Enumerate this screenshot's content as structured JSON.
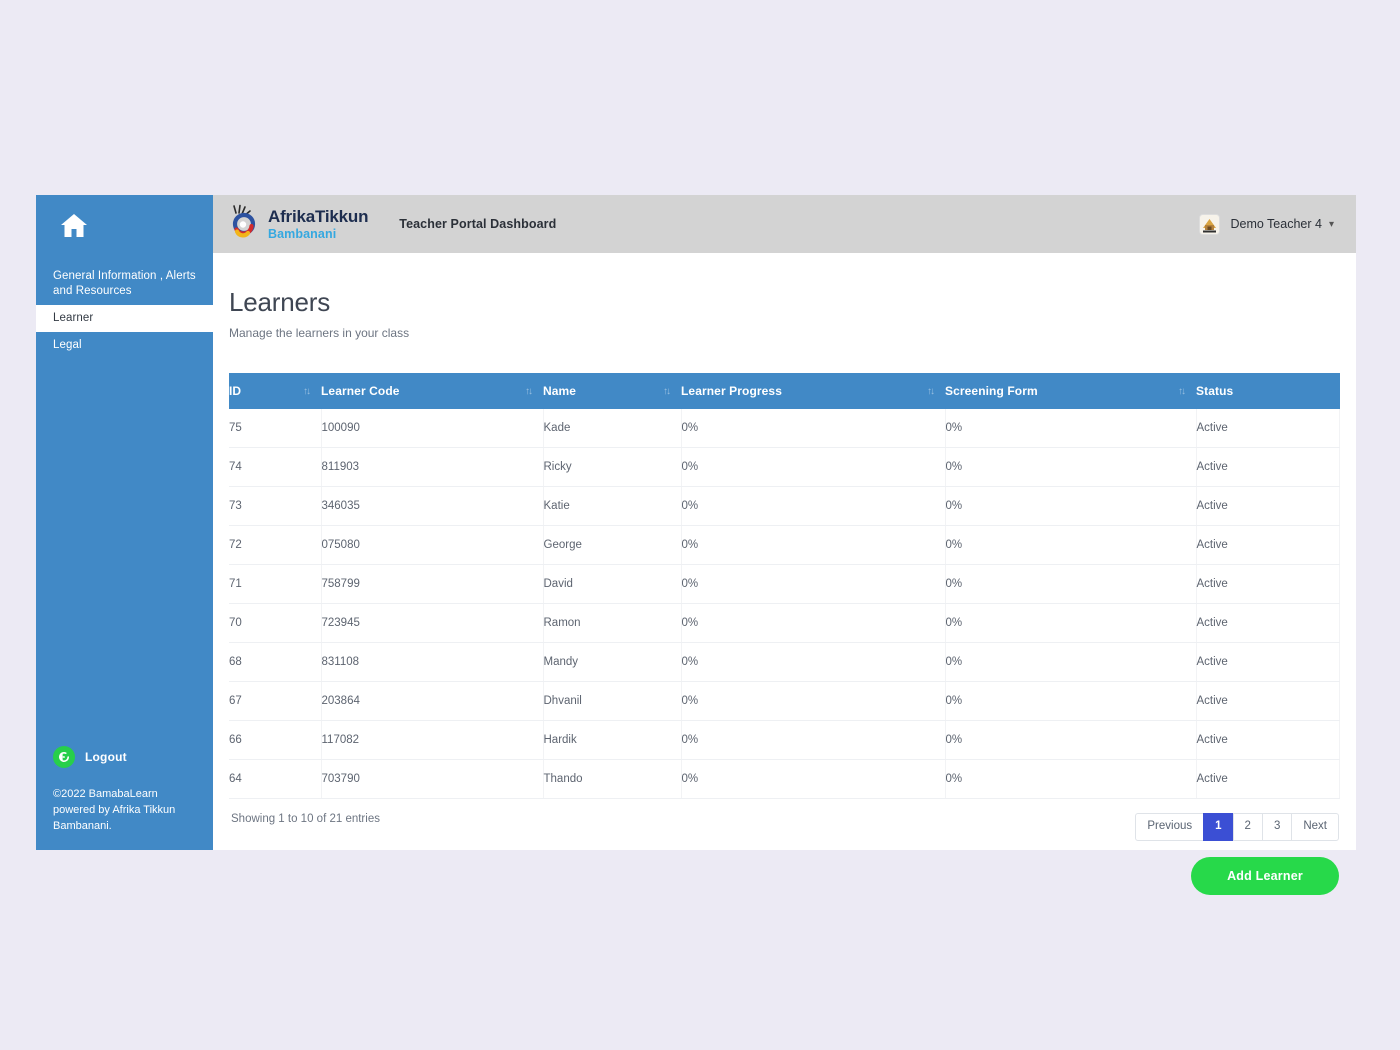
{
  "sidebar": {
    "home_icon": "home-icon",
    "items": [
      {
        "label": "General Information , Alerts and Resources",
        "active": false
      },
      {
        "label": "Learner",
        "active": true
      },
      {
        "label": "Legal",
        "active": false
      }
    ],
    "logout": {
      "icon": "logout-icon",
      "label": "Logout"
    },
    "copyright": "©2022 BamabaLearn powered by Afrika Tikkun Bambanani."
  },
  "topbar": {
    "brand_name": "AfrikaTikkun",
    "brand_sub": "Bambanani",
    "portal_title": "Teacher Portal Dashboard",
    "avatar_icon": "avatar",
    "user_name": "Demo Teacher 4",
    "caret_icon": "chevron-down-icon"
  },
  "page": {
    "title": "Learners",
    "subtitle": "Manage the learners in your class"
  },
  "table": {
    "sort_icon": "↑↓",
    "columns": [
      {
        "key": "id",
        "label": "ID",
        "sortable": true
      },
      {
        "key": "code",
        "label": "Learner Code",
        "sortable": true
      },
      {
        "key": "name",
        "label": "Name",
        "sortable": true
      },
      {
        "key": "progress",
        "label": "Learner Progress",
        "sortable": true
      },
      {
        "key": "screening",
        "label": "Screening Form",
        "sortable": true
      },
      {
        "key": "status",
        "label": "Status",
        "sortable": false
      }
    ],
    "rows": [
      {
        "id": "75",
        "code": "100090",
        "name": "Kade",
        "progress": "0%",
        "screening": "0%",
        "status": "Active"
      },
      {
        "id": "74",
        "code": "811903",
        "name": "Ricky",
        "progress": "0%",
        "screening": "0%",
        "status": "Active"
      },
      {
        "id": "73",
        "code": "346035",
        "name": "Katie",
        "progress": "0%",
        "screening": "0%",
        "status": "Active"
      },
      {
        "id": "72",
        "code": "075080",
        "name": "George",
        "progress": "0%",
        "screening": "0%",
        "status": "Active"
      },
      {
        "id": "71",
        "code": "758799",
        "name": "David",
        "progress": "0%",
        "screening": "0%",
        "status": "Active"
      },
      {
        "id": "70",
        "code": "723945",
        "name": "Ramon",
        "progress": "0%",
        "screening": "0%",
        "status": "Active"
      },
      {
        "id": "68",
        "code": "831108",
        "name": "Mandy",
        "progress": "0%",
        "screening": "0%",
        "status": "Active"
      },
      {
        "id": "67",
        "code": "203864",
        "name": "Dhvanil",
        "progress": "0%",
        "screening": "0%",
        "status": "Active"
      },
      {
        "id": "66",
        "code": "117082",
        "name": "Hardik",
        "progress": "0%",
        "screening": "0%",
        "status": "Active"
      },
      {
        "id": "64",
        "code": "703790",
        "name": "Thando",
        "progress": "0%",
        "screening": "0%",
        "status": "Active"
      }
    ]
  },
  "footer": {
    "showing": "Showing 1 to 10 of 21 entries",
    "pagination": [
      {
        "label": "Previous",
        "active": false
      },
      {
        "label": "1",
        "active": true
      },
      {
        "label": "2",
        "active": false
      },
      {
        "label": "3",
        "active": false
      },
      {
        "label": "Next",
        "active": false
      }
    ],
    "add_learner_label": "Add Learner"
  },
  "colors": {
    "page_background": "#eceaf4",
    "sidebar": "#4189c6",
    "table_header": "#4189c6",
    "topbar": "#d3d3d3",
    "status_active": "#7cd7a0",
    "add_button": "#27d94a",
    "page_active": "#3b4fd4",
    "brand_name": "#1d2d4f",
    "brand_sub": "#35a8e0"
  }
}
